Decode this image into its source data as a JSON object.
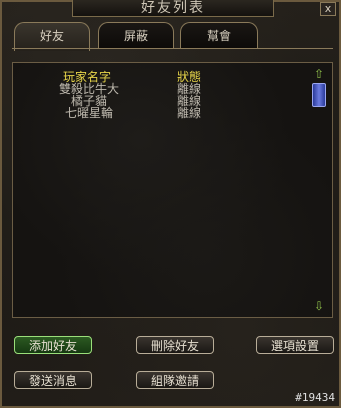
{
  "window": {
    "title": "好友列表",
    "close_label": "x"
  },
  "tabs": [
    {
      "label": "好友",
      "active": true
    },
    {
      "label": "屏蔽",
      "active": false
    },
    {
      "label": "幫會",
      "active": false
    }
  ],
  "list": {
    "columns": {
      "name": "玩家名字",
      "status": "狀態"
    },
    "rows": [
      {
        "name": "雙殺比牛大",
        "status": "離線"
      },
      {
        "name": "橘子貓",
        "status": "離線"
      },
      {
        "name": "七曜星輪",
        "status": "離線"
      }
    ]
  },
  "scroll": {
    "up": "⇧",
    "down": "⇩"
  },
  "buttons": {
    "add_friend": "添加好友",
    "delete_friend": "刪除好友",
    "settings": "選項設置",
    "send_message": "發送消息",
    "team_invite": "組隊邀請"
  },
  "footer": {
    "id": "#19434"
  },
  "colors": {
    "header": "#e8d64a",
    "text": "#bdb8ad",
    "accent_green": "#2c5a22",
    "scroll_thumb": "#4a5ad0"
  }
}
